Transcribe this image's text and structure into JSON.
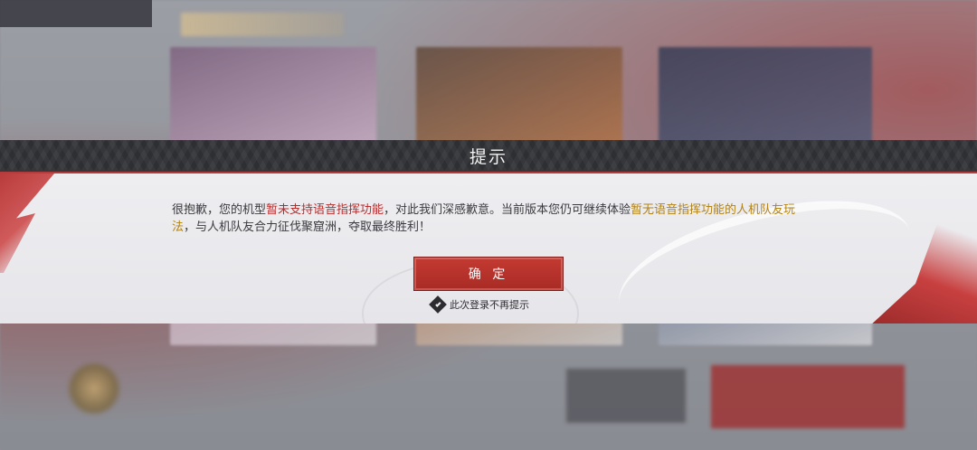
{
  "dialog": {
    "title": "提示",
    "message": {
      "p1": "很抱歉，您的机型",
      "p2": "暂未支持语音指挥功能",
      "p3": "，对此我们深感歉意。当前版本您仍可继续体验",
      "p4": "暂无语音指挥功能的人机队友玩法",
      "p5": "，与人机队友合力征伐聚窟洲，夺取最终胜利！"
    },
    "confirm_label": "确 定",
    "dont_show_label": "此次登录不再提示",
    "dont_show_checked": true
  },
  "colors": {
    "accent_red": "#b72c2c",
    "highlight_gold": "#b28213",
    "header_dark": "#2e2f33"
  }
}
